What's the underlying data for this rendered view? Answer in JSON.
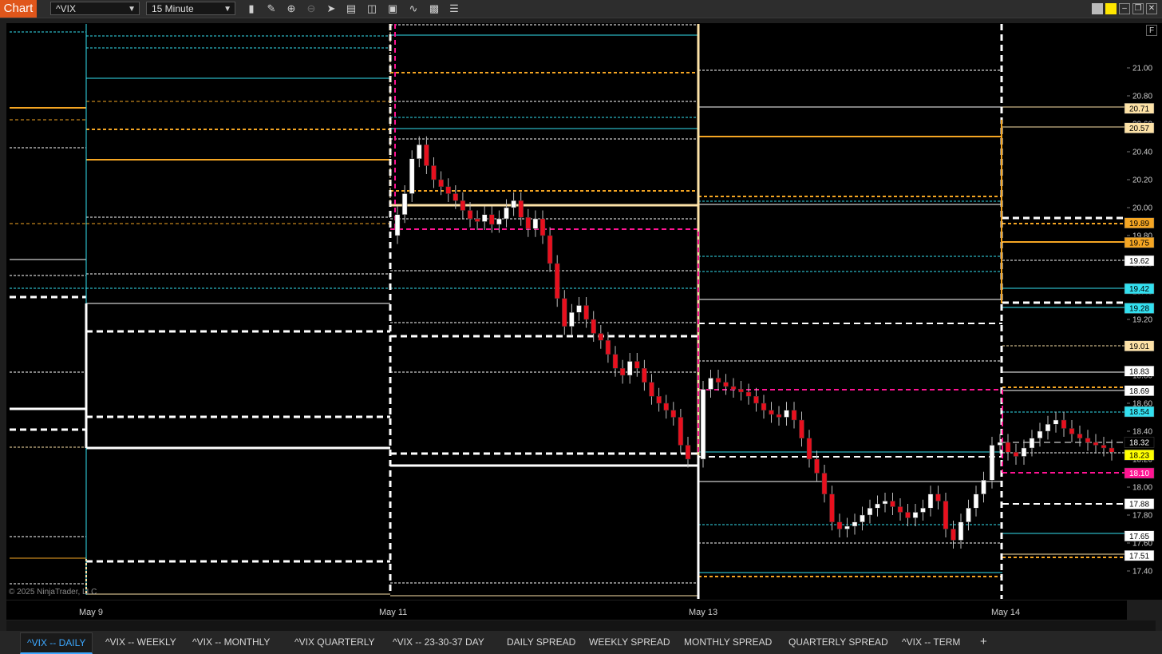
{
  "window": {
    "title": "Chart",
    "instrument": "^VIX",
    "interval": "15 Minute",
    "toolbar_icons": [
      "bar-type-icon",
      "draw-icon",
      "zoom-in-icon",
      "zoom-out-icon",
      "select-icon",
      "properties-icon",
      "templates-icon",
      "data-box-icon",
      "indicators-icon",
      "strategies-icon",
      "more-icon"
    ],
    "window_buttons": [
      "grey-swatch-icon",
      "yellow-swatch-icon",
      "minimize-icon",
      "restore-icon",
      "maximize-icon",
      "close-icon"
    ],
    "f_button": "F"
  },
  "price_axis": {
    "ticks": [
      "21.00",
      "20.80",
      "20.60",
      "20.40",
      "20.20",
      "20.00",
      "19.80",
      "19.60",
      "19.40",
      "19.20",
      "19.00",
      "18.80",
      "18.60",
      "18.40",
      "18.20",
      "18.00",
      "17.80",
      "17.60",
      "17.40"
    ],
    "markers": [
      {
        "text": "20.71",
        "bg": "#fde2a7",
        "fg": "#000"
      },
      {
        "text": "20.57",
        "bg": "#fde2a7",
        "fg": "#000"
      },
      {
        "text": "19.89",
        "bg": "#f5a623",
        "fg": "#000"
      },
      {
        "text": "19.75",
        "bg": "#f5a623",
        "fg": "#000"
      },
      {
        "text": "19.62",
        "bg": "#ffffff",
        "fg": "#000"
      },
      {
        "text": "19.42",
        "bg": "#33e0f0",
        "fg": "#000"
      },
      {
        "text": "19.28",
        "bg": "#33e0f0",
        "fg": "#000"
      },
      {
        "text": "19.01",
        "bg": "#fde2a7",
        "fg": "#000"
      },
      {
        "text": "18.83",
        "bg": "#ffffff",
        "fg": "#000"
      },
      {
        "text": "18.69",
        "bg": "#ffffff",
        "fg": "#000"
      },
      {
        "text": "18.54",
        "bg": "#33e0f0",
        "fg": "#000"
      },
      {
        "text": "18.32",
        "bg": "#000000",
        "fg": "#fff"
      },
      {
        "text": "18.23",
        "bg": "#ffff00",
        "fg": "#000"
      },
      {
        "text": "18.10",
        "bg": "#ff1493",
        "fg": "#fff"
      },
      {
        "text": "17.88",
        "bg": "#ffffff",
        "fg": "#000"
      },
      {
        "text": "17.65",
        "bg": "#ffffff",
        "fg": "#000"
      },
      {
        "text": "17.51",
        "bg": "#ffffff",
        "fg": "#000"
      }
    ]
  },
  "time_axis": {
    "labels": [
      "May 9",
      "May 11",
      "May 13",
      "May 14"
    ]
  },
  "watermark": "© 2025 NinjaTrader, LLC",
  "tabs": [
    {
      "label": "^VIX -- DAILY",
      "active": true
    },
    {
      "label": "^VIX -- WEEKLY",
      "active": false
    },
    {
      "label": "^VIX -- MONTHLY",
      "active": false
    },
    {
      "label": "^VIX QUARTERLY",
      "active": false
    },
    {
      "label": "^VIX -- 23-30-37 DAY",
      "active": false
    },
    {
      "label": "DAILY SPREAD",
      "active": false
    },
    {
      "label": "WEEKLY SPREAD",
      "active": false
    },
    {
      "label": "MONTHLY SPREAD",
      "active": false
    },
    {
      "label": "QUARTERLY SPREAD",
      "active": false
    },
    {
      "label": "^VIX -- TERM",
      "active": false
    }
  ],
  "add_tab": "+",
  "colors": {
    "up_candle": "#ffffff",
    "down_candle": "#e8101e",
    "cyan": "#33e0f0",
    "orange": "#f5a623",
    "light_orange": "#fde2a7",
    "magenta": "#ff1493",
    "accent_tab": "#3da8ff"
  },
  "chart_data": {
    "type": "candlestick",
    "instrument": "^VIX",
    "interval": "15 Minute",
    "ylim": [
      17.3,
      21.2
    ],
    "closes": [
      19.95,
      20.1,
      20.35,
      20.45,
      20.3,
      20.2,
      20.15,
      20.1,
      20.05,
      19.98,
      19.92,
      19.9,
      19.95,
      19.88,
      19.92,
      20.0,
      20.05,
      19.93,
      19.85,
      19.92,
      19.8,
      19.6,
      19.35,
      19.15,
      19.25,
      19.3,
      19.2,
      19.1,
      19.05,
      18.95,
      18.85,
      18.8,
      18.9,
      18.85,
      18.75,
      18.65,
      18.6,
      18.55,
      18.5,
      18.3,
      18.2,
      18.7,
      18.78,
      18.75,
      18.72,
      18.7,
      18.68,
      18.65,
      18.6,
      18.55,
      18.52,
      18.5,
      18.55,
      18.48,
      18.35,
      18.2,
      18.1,
      17.95,
      17.75,
      17.7,
      17.72,
      17.75,
      17.8,
      17.85,
      17.88,
      17.9,
      17.86,
      17.82,
      17.78,
      17.82,
      17.85,
      17.95,
      17.9,
      17.7,
      17.62,
      17.75,
      17.85,
      17.95,
      18.05,
      18.3,
      18.32,
      18.25,
      18.22,
      18.28,
      18.35,
      18.4,
      18.45,
      18.48,
      18.42,
      18.38,
      18.35,
      18.32,
      18.3,
      18.28,
      18.25
    ]
  }
}
